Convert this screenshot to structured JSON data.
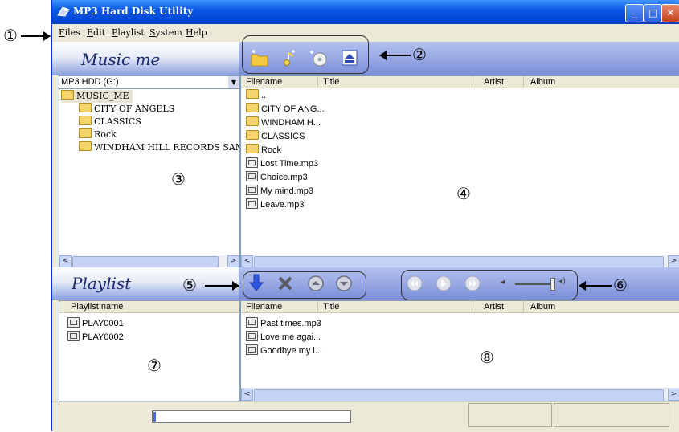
{
  "window": {
    "title": "MP3 Hard Disk Utility",
    "minimize": "_",
    "maximize": "□",
    "close": "✕"
  },
  "menu": [
    "Files",
    "Edit",
    "Playlist",
    "System",
    "Help"
  ],
  "callouts": {
    "c1": "①",
    "c2": "②",
    "c3": "③",
    "c4": "④",
    "c5": "⑤",
    "c6": "⑥",
    "c7": "⑦",
    "c8": "⑧"
  },
  "logos": {
    "top": "Music me",
    "bottom": "Playlist"
  },
  "toolbar_icons": [
    "new-folder-icon",
    "add-music-icon",
    "add-cd-icon",
    "eject-icon"
  ],
  "drive_select": "MP3 HDD (G:)",
  "tree": {
    "root": "MUSIC_ME",
    "children": [
      "CITY OF ANGELS",
      "CLASSICS",
      "Rock",
      "WINDHAM HILL RECORDS SAM"
    ]
  },
  "file_columns": [
    "Filename",
    "Title",
    "Artist",
    "Album"
  ],
  "files": [
    {
      "name": "..",
      "type": "folder"
    },
    {
      "name": "CITY OF ANG...",
      "type": "folder"
    },
    {
      "name": "WINDHAM H...",
      "type": "folder"
    },
    {
      "name": "CLASSICS",
      "type": "folder"
    },
    {
      "name": "Rock",
      "type": "folder"
    },
    {
      "name": "Lost Time.mp3",
      "type": "mp3"
    },
    {
      "name": "Choice.mp3",
      "type": "mp3"
    },
    {
      "name": "My mind.mp3",
      "type": "mp3"
    },
    {
      "name": "Leave.mp3",
      "type": "mp3"
    }
  ],
  "playlist_column": "Playlist name",
  "playlists": [
    "PLAY0001",
    "PLAY0002"
  ],
  "playlist_files": [
    "Past times.mp3",
    "Love me agai...",
    "Goodbye my l..."
  ],
  "playback_icons": [
    "rewind-icon",
    "play-icon",
    "fast-forward-icon"
  ],
  "volume": 0.9,
  "colors": {
    "titlebar": "#0054e3",
    "band": "#8aa0e0",
    "accent": "#3355cc"
  }
}
